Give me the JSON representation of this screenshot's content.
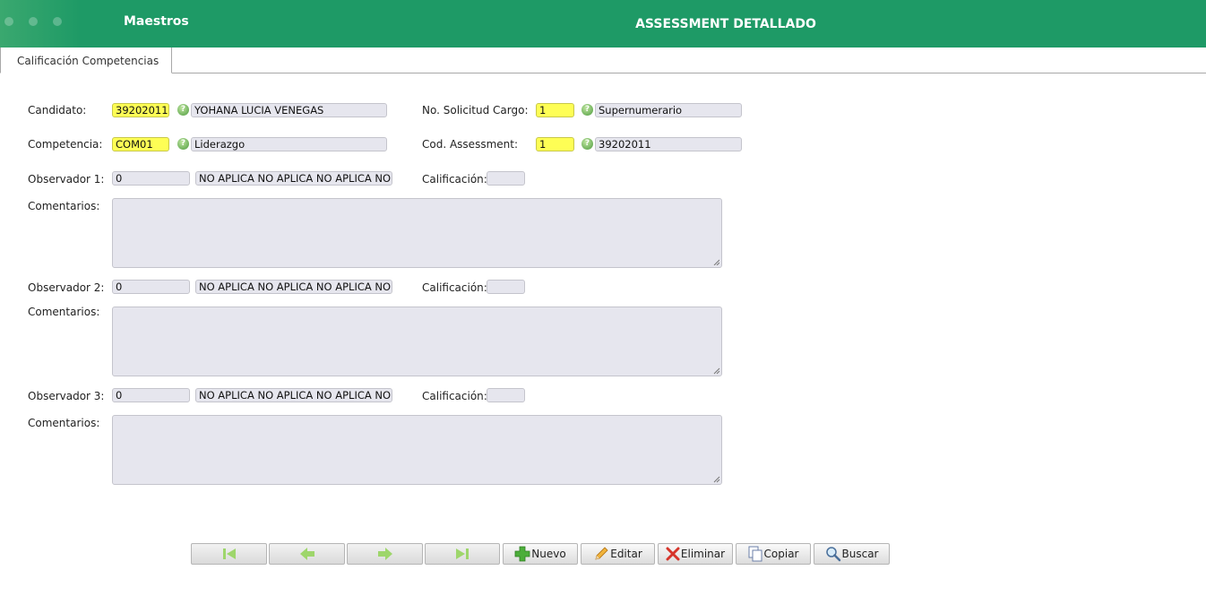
{
  "header": {
    "app_name": "Maestros",
    "title": "ASSESSMENT DETALLADO"
  },
  "tabs": [
    {
      "label": "Calificación Competencias"
    }
  ],
  "form": {
    "candidato": {
      "label": "Candidato:",
      "code": "39202011",
      "name": "YOHANA LUCIA VENEGAS"
    },
    "solicitud": {
      "label": "No. Solicitud Cargo:",
      "code": "1",
      "name": "Supernumerario"
    },
    "competencia": {
      "label": "Competencia:",
      "code": "COM01",
      "name": "Liderazgo"
    },
    "assessment": {
      "label": "Cod. Assessment:",
      "code": "1",
      "name": "39202011"
    },
    "observers": [
      {
        "label": "Observador 1:",
        "code": "0",
        "name": "NO APLICA NO APLICA NO APLICA NO",
        "calif_label": "Calificación:",
        "calif_value": "",
        "comments_label": "Comentarios:",
        "comments": ""
      },
      {
        "label": "Observador 2:",
        "code": "0",
        "name": "NO APLICA NO APLICA NO APLICA NO",
        "calif_label": "Calificación:",
        "calif_value": "",
        "comments_label": "Comentarios:",
        "comments": ""
      },
      {
        "label": "Observador 3:",
        "code": "0",
        "name": "NO APLICA NO APLICA NO APLICA NO",
        "calif_label": "Calificación:",
        "calif_value": "",
        "comments_label": "Comentarios:",
        "comments": ""
      }
    ]
  },
  "toolbar": {
    "first": {
      "icon": "first-record-icon"
    },
    "prev": {
      "icon": "previous-record-icon"
    },
    "next": {
      "icon": "next-record-icon"
    },
    "last": {
      "icon": "last-record-icon"
    },
    "nuevo": {
      "label": "Nuevo",
      "icon": "plus-icon"
    },
    "editar": {
      "label": "Editar",
      "icon": "pencil-icon"
    },
    "eliminar": {
      "label": "Eliminar",
      "icon": "delete-x-icon"
    },
    "copiar": {
      "label": "Copiar",
      "icon": "copy-icon"
    },
    "buscar": {
      "label": "Buscar",
      "icon": "magnifier-icon"
    }
  },
  "colors": {
    "header_green": "#1e9a66",
    "required_field": "#fefe55",
    "readonly_field": "#e6e6ee",
    "nav_arrow": "#9ed66b"
  }
}
